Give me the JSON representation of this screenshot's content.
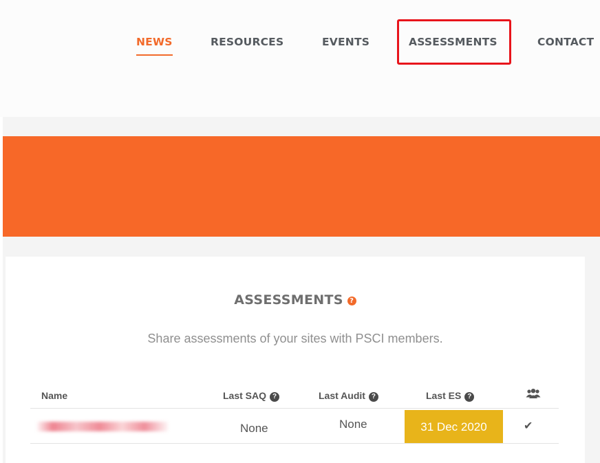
{
  "nav": {
    "items": [
      "NEWS",
      "RESOURCES",
      "EVENTS",
      "ASSESSMENTS",
      "CONTACT"
    ],
    "active": "NEWS",
    "highlighted": "ASSESSMENTS"
  },
  "colors": {
    "accent": "#f76828",
    "highlight_border": "#e8141b",
    "date_badge": "#e8b41a"
  },
  "section": {
    "title": "ASSESSMENTS",
    "subtitle": "Share assessments of your sites with PSCI members."
  },
  "table": {
    "headers": [
      "Name",
      "Last SAQ",
      "Last Audit",
      "Last ES"
    ],
    "share_column_icon": "users-icon",
    "rows": [
      {
        "name": "",
        "last_saq": "None",
        "last_audit": "None",
        "last_es": "31 Dec 2020",
        "shared": true
      }
    ]
  }
}
